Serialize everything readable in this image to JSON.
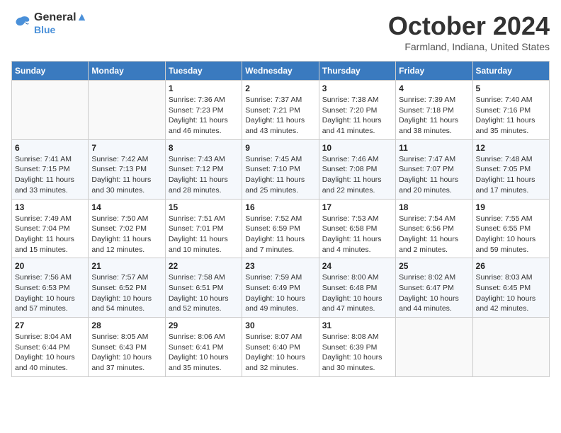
{
  "header": {
    "logo_line1": "General",
    "logo_line2": "Blue",
    "month_title": "October 2024",
    "location": "Farmland, Indiana, United States"
  },
  "days_of_week": [
    "Sunday",
    "Monday",
    "Tuesday",
    "Wednesday",
    "Thursday",
    "Friday",
    "Saturday"
  ],
  "weeks": [
    [
      {
        "day": "",
        "info": ""
      },
      {
        "day": "",
        "info": ""
      },
      {
        "day": "1",
        "info": "Sunrise: 7:36 AM\nSunset: 7:23 PM\nDaylight: 11 hours and 46 minutes."
      },
      {
        "day": "2",
        "info": "Sunrise: 7:37 AM\nSunset: 7:21 PM\nDaylight: 11 hours and 43 minutes."
      },
      {
        "day": "3",
        "info": "Sunrise: 7:38 AM\nSunset: 7:20 PM\nDaylight: 11 hours and 41 minutes."
      },
      {
        "day": "4",
        "info": "Sunrise: 7:39 AM\nSunset: 7:18 PM\nDaylight: 11 hours and 38 minutes."
      },
      {
        "day": "5",
        "info": "Sunrise: 7:40 AM\nSunset: 7:16 PM\nDaylight: 11 hours and 35 minutes."
      }
    ],
    [
      {
        "day": "6",
        "info": "Sunrise: 7:41 AM\nSunset: 7:15 PM\nDaylight: 11 hours and 33 minutes."
      },
      {
        "day": "7",
        "info": "Sunrise: 7:42 AM\nSunset: 7:13 PM\nDaylight: 11 hours and 30 minutes."
      },
      {
        "day": "8",
        "info": "Sunrise: 7:43 AM\nSunset: 7:12 PM\nDaylight: 11 hours and 28 minutes."
      },
      {
        "day": "9",
        "info": "Sunrise: 7:45 AM\nSunset: 7:10 PM\nDaylight: 11 hours and 25 minutes."
      },
      {
        "day": "10",
        "info": "Sunrise: 7:46 AM\nSunset: 7:08 PM\nDaylight: 11 hours and 22 minutes."
      },
      {
        "day": "11",
        "info": "Sunrise: 7:47 AM\nSunset: 7:07 PM\nDaylight: 11 hours and 20 minutes."
      },
      {
        "day": "12",
        "info": "Sunrise: 7:48 AM\nSunset: 7:05 PM\nDaylight: 11 hours and 17 minutes."
      }
    ],
    [
      {
        "day": "13",
        "info": "Sunrise: 7:49 AM\nSunset: 7:04 PM\nDaylight: 11 hours and 15 minutes."
      },
      {
        "day": "14",
        "info": "Sunrise: 7:50 AM\nSunset: 7:02 PM\nDaylight: 11 hours and 12 minutes."
      },
      {
        "day": "15",
        "info": "Sunrise: 7:51 AM\nSunset: 7:01 PM\nDaylight: 11 hours and 10 minutes."
      },
      {
        "day": "16",
        "info": "Sunrise: 7:52 AM\nSunset: 6:59 PM\nDaylight: 11 hours and 7 minutes."
      },
      {
        "day": "17",
        "info": "Sunrise: 7:53 AM\nSunset: 6:58 PM\nDaylight: 11 hours and 4 minutes."
      },
      {
        "day": "18",
        "info": "Sunrise: 7:54 AM\nSunset: 6:56 PM\nDaylight: 11 hours and 2 minutes."
      },
      {
        "day": "19",
        "info": "Sunrise: 7:55 AM\nSunset: 6:55 PM\nDaylight: 10 hours and 59 minutes."
      }
    ],
    [
      {
        "day": "20",
        "info": "Sunrise: 7:56 AM\nSunset: 6:53 PM\nDaylight: 10 hours and 57 minutes."
      },
      {
        "day": "21",
        "info": "Sunrise: 7:57 AM\nSunset: 6:52 PM\nDaylight: 10 hours and 54 minutes."
      },
      {
        "day": "22",
        "info": "Sunrise: 7:58 AM\nSunset: 6:51 PM\nDaylight: 10 hours and 52 minutes."
      },
      {
        "day": "23",
        "info": "Sunrise: 7:59 AM\nSunset: 6:49 PM\nDaylight: 10 hours and 49 minutes."
      },
      {
        "day": "24",
        "info": "Sunrise: 8:00 AM\nSunset: 6:48 PM\nDaylight: 10 hours and 47 minutes."
      },
      {
        "day": "25",
        "info": "Sunrise: 8:02 AM\nSunset: 6:47 PM\nDaylight: 10 hours and 44 minutes."
      },
      {
        "day": "26",
        "info": "Sunrise: 8:03 AM\nSunset: 6:45 PM\nDaylight: 10 hours and 42 minutes."
      }
    ],
    [
      {
        "day": "27",
        "info": "Sunrise: 8:04 AM\nSunset: 6:44 PM\nDaylight: 10 hours and 40 minutes."
      },
      {
        "day": "28",
        "info": "Sunrise: 8:05 AM\nSunset: 6:43 PM\nDaylight: 10 hours and 37 minutes."
      },
      {
        "day": "29",
        "info": "Sunrise: 8:06 AM\nSunset: 6:41 PM\nDaylight: 10 hours and 35 minutes."
      },
      {
        "day": "30",
        "info": "Sunrise: 8:07 AM\nSunset: 6:40 PM\nDaylight: 10 hours and 32 minutes."
      },
      {
        "day": "31",
        "info": "Sunrise: 8:08 AM\nSunset: 6:39 PM\nDaylight: 10 hours and 30 minutes."
      },
      {
        "day": "",
        "info": ""
      },
      {
        "day": "",
        "info": ""
      }
    ]
  ]
}
